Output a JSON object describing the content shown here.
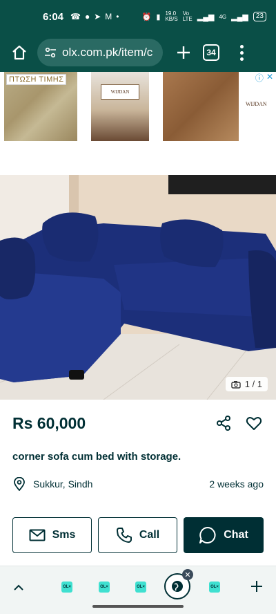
{
  "status_bar": {
    "time": "6:04",
    "network_speed": "19.0\nKB/S",
    "network_label": "Vo\nLTE",
    "signal_label": "4G",
    "battery": "23"
  },
  "browser": {
    "url": "olx.com.pk/item/c",
    "tab_count": "34"
  },
  "ad": {
    "label_left": "ΠΤΩΣΗ ΤΙΜΗΣ",
    "brand": "WIJDAN",
    "brand_right": "WIJDAN"
  },
  "listing": {
    "photo_counter": "1 / 1",
    "price": "Rs 60,000",
    "title": "corner sofa cum bed with storage.",
    "location": "Sukkur, Sindh",
    "posted": "2 weeks ago"
  },
  "actions": {
    "sms_label": "Sms",
    "call_label": "Call",
    "chat_label": "Chat"
  },
  "bottom_tabs": {
    "mini_tab_label": "OL×"
  },
  "colors": {
    "brand_dark": "#002f34",
    "browser_green": "#0a4f47",
    "olx_teal": "#3fe0d0",
    "sofa_blue": "#1c2f7a"
  }
}
